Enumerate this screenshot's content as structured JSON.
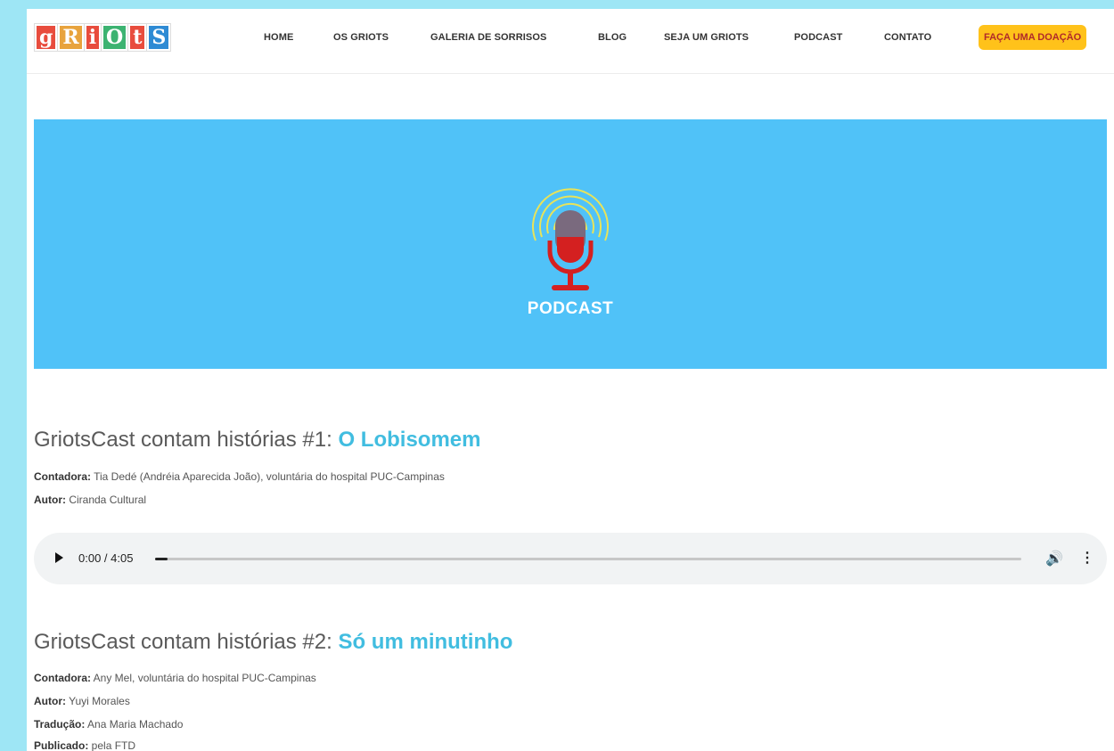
{
  "header": {
    "logo_letters": [
      "g",
      "R",
      "i",
      "O",
      "t",
      "S"
    ],
    "logo_colors": [
      "#e84c3d",
      "#e8a33d",
      "#e84c3d",
      "#3cb371",
      "#e84c3d",
      "#2e8bd4"
    ],
    "nav": [
      "HOME",
      "OS GRIOTS",
      "GALERIA DE SORRISOS",
      "BLOG",
      "SEJA UM GRIOTS",
      "PODCAST",
      "CONTATO"
    ],
    "donate_label": "FAÇA UMA DOAÇÃO"
  },
  "banner": {
    "label": "PODCAST",
    "icon": "microphone-icon",
    "background": "#50c2f8"
  },
  "episodes": [
    {
      "title_prefix": "GriotsCast contam histórias #1: ",
      "title_highlight": "O Lobisomem",
      "meta": [
        {
          "label": "Contadora:",
          "value": " Tia Dedé (Andréia Aparecida João), voluntária do hospital PUC-Campinas"
        },
        {
          "label": "Autor:",
          "value": " Ciranda Cultural"
        }
      ],
      "player": {
        "time": "0:00 / 4:05",
        "progress": 0.0
      }
    },
    {
      "title_prefix": "GriotsCast contam histórias #2: ",
      "title_highlight": "Só um minutinho",
      "meta": [
        {
          "label": "Contadora:",
          "value": " Any Mel, voluntária do hospital PUC-Campinas"
        },
        {
          "label": "Autor:",
          "value": " Yuyi Morales"
        },
        {
          "label": "Tradução:",
          "value": " Ana Maria Machado"
        },
        {
          "label": "Publicado:",
          "value": " pela FTD"
        }
      ]
    }
  ],
  "colors": {
    "accent": "#41bde0",
    "donate_bg": "#ffc21a",
    "donate_text": "#b12a2a"
  }
}
